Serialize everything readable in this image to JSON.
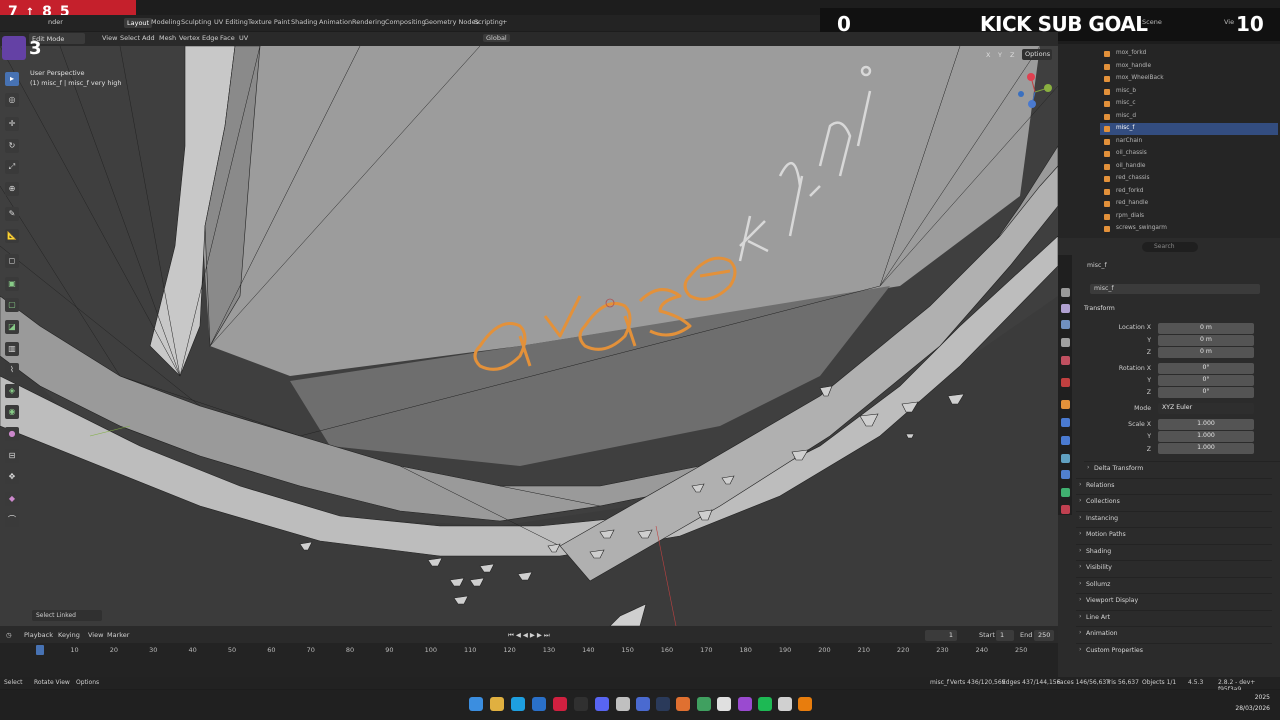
{
  "overlay": {
    "stats": [
      "7",
      "8",
      "5"
    ],
    "twitch_count": "3",
    "goal": {
      "left": "0",
      "title": "KICK SUB GOAL",
      "right": "10"
    }
  },
  "workspaces": [
    "Layout",
    "Modeling",
    "Sculpting",
    "UV Editing",
    "Texture Paint",
    "Shading",
    "Animation",
    "Rendering",
    "Compositing",
    "Geometry Nodes",
    "Scripting"
  ],
  "menu_partial": "nder",
  "scene_label": "Scene",
  "viewlayer_label": "Vie",
  "viewport": {
    "mode": "Edit Mode",
    "menus": [
      "View",
      "Select",
      "Add",
      "Mesh",
      "Vertex",
      "Edge",
      "Face",
      "UV"
    ],
    "orientation": "Global",
    "info_line1": "User Perspective",
    "info_line2": "(1) misc_f | misc_f very high",
    "axes": [
      "X",
      "Y",
      "Z"
    ],
    "options": "Options",
    "last_op": "Select Linked",
    "mesh_text": "avaseki"
  },
  "timeline": {
    "menus": [
      "Playback",
      "Keying",
      "View",
      "Marker"
    ],
    "current_frame": "1",
    "start_label": "Start",
    "start": "1",
    "end_label": "End",
    "end": "250",
    "ticks": [
      "10",
      "20",
      "30",
      "40",
      "50",
      "60",
      "70",
      "80",
      "90",
      "100",
      "110",
      "120",
      "130",
      "140",
      "150",
      "160",
      "170",
      "180",
      "190",
      "200",
      "210",
      "220",
      "230",
      "240",
      "250"
    ]
  },
  "status": {
    "left": [
      "Select",
      "Rotate View",
      "Options"
    ],
    "object": "misc_f",
    "verts": "Verts 436/120,569",
    "edges": "Edges 437/144,156",
    "faces": "Faces 146/56,637",
    "tris": "Tris 56,637",
    "objects": "Objects 1/1",
    "version": "4.5.3",
    "build": "2.8.2 - dev+ f95f3a9"
  },
  "outliner": {
    "items": [
      "mox_forkd",
      "mox_handle",
      "mox_WheelBack",
      "misc_b",
      "misc_c",
      "misc_d",
      "misc_f",
      "narChain",
      "oil_chassis",
      "oil_handle",
      "red_chassis",
      "red_forkd",
      "red_handle",
      "rpm_dials",
      "screws_swingarm"
    ],
    "selected": "misc_f"
  },
  "properties": {
    "search": "Search",
    "object_name": "misc_f",
    "data_name": "misc_f",
    "transform": "Transform",
    "location_label": "Location X",
    "location": [
      "0 m",
      "0 m",
      "0 m"
    ],
    "rotation_label": "Rotation X",
    "rotation": [
      "0°",
      "0°",
      "0°"
    ],
    "mode_label": "Mode",
    "mode": "XYZ Euler",
    "scale_label": "Scale X",
    "scale": [
      "1.000",
      "1.000",
      "1.000"
    ],
    "axis_y": "Y",
    "axis_z": "Z",
    "sections": [
      "Delta Transform",
      "Relations",
      "Collections",
      "Instancing",
      "Motion Paths",
      "Shading",
      "Visibility",
      "Sollumz",
      "Viewport Display",
      "Line Art",
      "Animation",
      "Custom Properties"
    ]
  },
  "taskbar": {
    "time": "2025",
    "date": "28/03/2026"
  },
  "colors": {
    "accent": "#4772b3",
    "selected_mesh": "#e3913a",
    "overlay_red": "#c5202c",
    "twitch": "#6441a5"
  }
}
